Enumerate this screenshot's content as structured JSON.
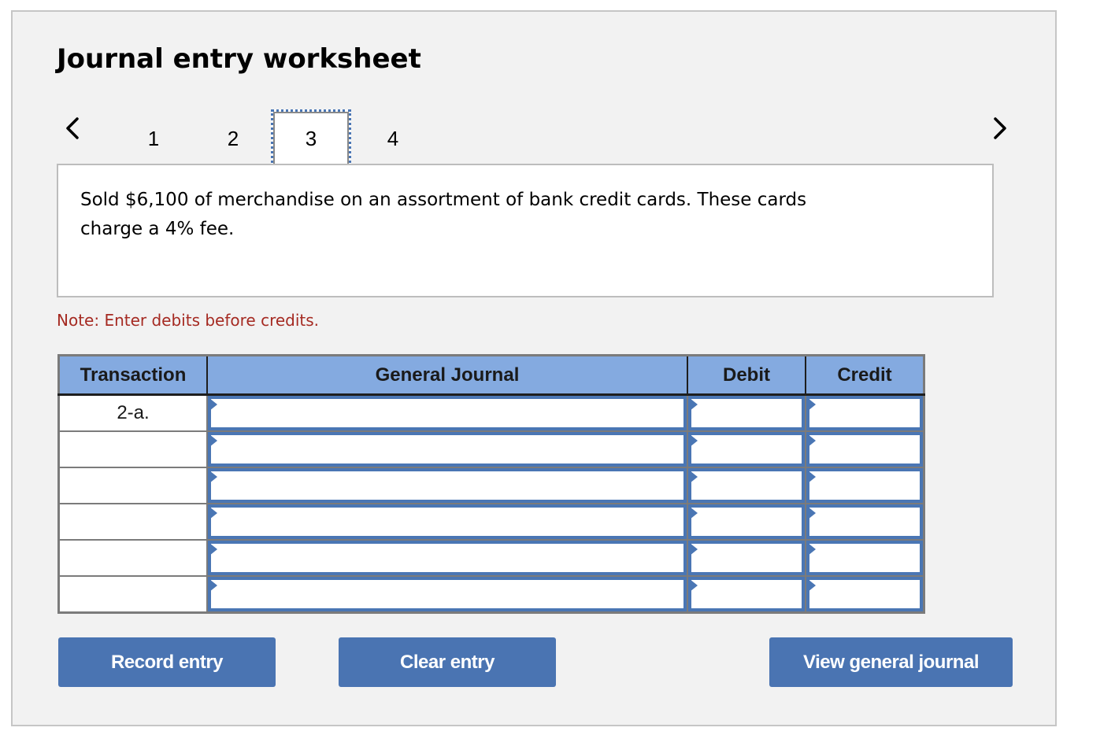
{
  "worksheet": {
    "title": "Journal entry worksheet",
    "nav": {
      "prev_icon": "chevron-left-icon",
      "next_icon": "chevron-right-icon",
      "tabs": [
        {
          "label": "1",
          "active": false
        },
        {
          "label": "2",
          "active": false
        },
        {
          "label": "3",
          "active": true
        },
        {
          "label": "4",
          "active": false
        }
      ]
    },
    "question_text": "Sold $6,100 of merchandise on an assortment of bank credit cards. These cards charge a 4% fee.",
    "note": "Note: Enter debits before credits.",
    "table": {
      "headers": {
        "transaction": "Transaction",
        "general_journal": "General Journal",
        "debit": "Debit",
        "credit": "Credit"
      },
      "rows": [
        {
          "transaction": "2-a.",
          "account": "",
          "debit": "",
          "credit": ""
        },
        {
          "transaction": "",
          "account": "",
          "debit": "",
          "credit": ""
        },
        {
          "transaction": "",
          "account": "",
          "debit": "",
          "credit": ""
        },
        {
          "transaction": "",
          "account": "",
          "debit": "",
          "credit": ""
        },
        {
          "transaction": "",
          "account": "",
          "debit": "",
          "credit": ""
        },
        {
          "transaction": "",
          "account": "",
          "debit": "",
          "credit": ""
        }
      ]
    },
    "buttons": {
      "record": "Record entry",
      "clear": "Clear entry",
      "view": "View general journal"
    },
    "colors": {
      "accent": "#4a74b2",
      "header_bg": "#84aae0",
      "note": "#a52a22",
      "panel_bg": "#f2f2f2"
    }
  }
}
